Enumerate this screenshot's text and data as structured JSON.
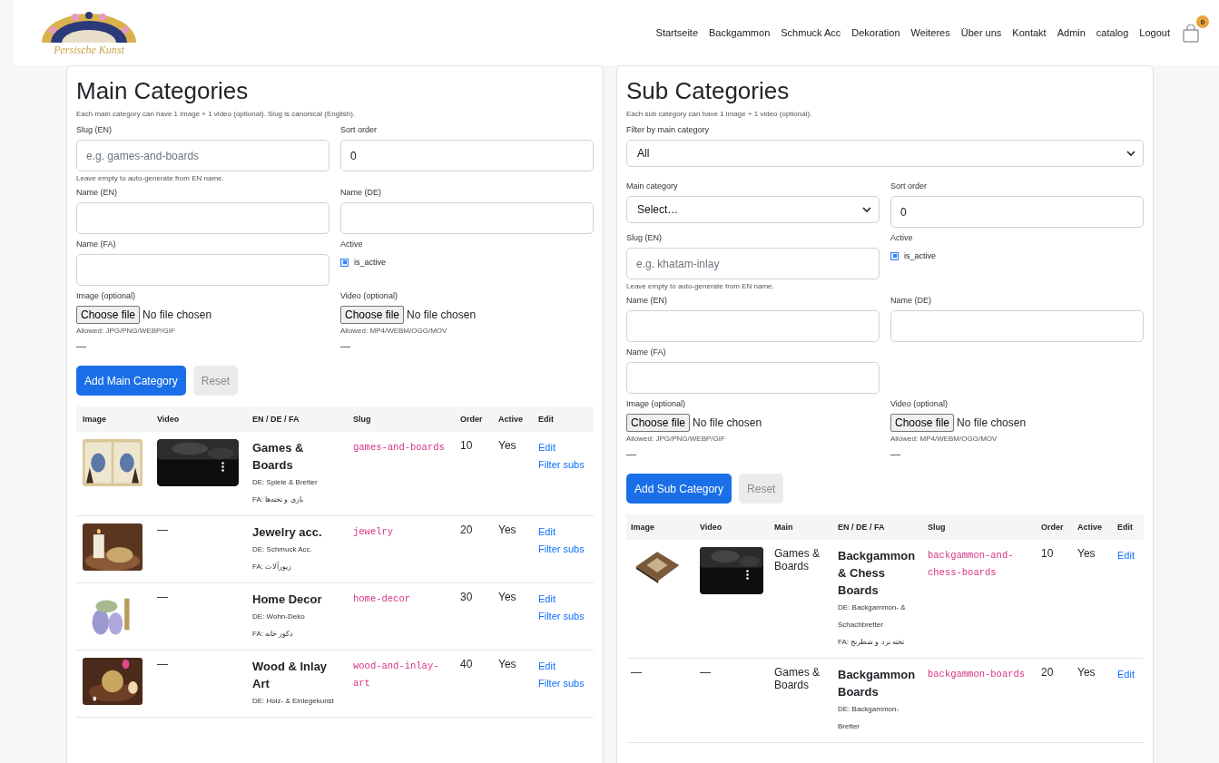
{
  "header": {
    "logo_text": "Persische Kunst",
    "nav": [
      {
        "label": "Startseite"
      },
      {
        "label": "Backgammon"
      },
      {
        "label": "Schmuck Acc"
      },
      {
        "label": "Dekoration"
      },
      {
        "label": "Weiteres"
      },
      {
        "label": "Über uns"
      },
      {
        "label": "Kontakt"
      },
      {
        "label": "Admin"
      },
      {
        "label": "catalog"
      },
      {
        "label": "Logout"
      }
    ],
    "cart_count": "0"
  },
  "panels": [
    {
      "title": "Main Categories",
      "description": "Each main category can have 1 image + 1 video (optional). Slug is canonical (English).",
      "rows": [
        [
          {
            "kind": "input",
            "label": "Slug (EN)",
            "placeholder": "e.g. games-and-boards",
            "hint": "Leave empty to auto-generate from EN name."
          },
          {
            "kind": "input",
            "label": "Sort order",
            "value": "0"
          }
        ],
        [
          {
            "kind": "input",
            "label": "Name (EN)"
          },
          {
            "kind": "input",
            "label": "Name (DE)"
          }
        ],
        [
          {
            "kind": "input",
            "label": "Name (FA)"
          },
          {
            "kind": "checkbox",
            "label": "Active",
            "option": "is_active",
            "checked": true
          }
        ],
        [
          {
            "kind": "file",
            "label": "Image (optional)",
            "button": "Choose file",
            "status": "No file chosen",
            "hint": "Allowed: JPG/PNG/WEBP/GIF",
            "preview": "—"
          },
          {
            "kind": "file",
            "label": "Video (optional)",
            "button": "Choose file",
            "status": "No file chosen",
            "hint": "Allowed: MP4/WEBM/OGG/MOV",
            "preview": "—"
          }
        ]
      ],
      "buttons": [
        {
          "label": "Add Main Category",
          "kind": "primary",
          "disabled": false
        },
        {
          "label": "Reset",
          "kind": "secondary",
          "disabled": true
        }
      ],
      "table": {
        "columns": [
          "Image",
          "Video",
          "EN / DE / FA",
          "Slug",
          "Order",
          "Active",
          "Edit"
        ],
        "rows": [
          {
            "image": {
              "kind": "picture"
            },
            "video": {
              "kind": "picture"
            },
            "name": "Games & Boards",
            "de": "DE: Spiele & Bretter",
            "fa": "FA: بازی و تخته‌ها",
            "slug": "games-and-boards",
            "order": "10",
            "active": "Yes",
            "links": [
              "Edit",
              "Filter subs"
            ]
          },
          {
            "image": {
              "kind": "picture"
            },
            "video": "—",
            "name": "Jewelry acc.",
            "de": "DE: Schmuck Acc.",
            "fa": "FA: زیورآلات",
            "slug": "jewelry",
            "order": "20",
            "active": "Yes",
            "links": [
              "Edit",
              "Filter subs"
            ]
          },
          {
            "image": {
              "kind": "picture"
            },
            "video": "—",
            "name": "Home Decor",
            "de": "DE: Wohn-Deko",
            "fa": "FA: دکور خانه",
            "slug": "home-decor",
            "order": "30",
            "active": "Yes",
            "links": [
              "Edit",
              "Filter subs"
            ]
          },
          {
            "image": {
              "kind": "picture"
            },
            "video": "—",
            "name": "Wood & Inlay Art",
            "de": "DE: Holz- & Einlegekunst",
            "slug": "wood-and-inlay-art",
            "order": "40",
            "active": "Yes",
            "links": [
              "Edit",
              "Filter subs"
            ]
          }
        ]
      }
    },
    {
      "title": "Sub Categories",
      "description": "Each sub category can have 1 image + 1 video (optional).",
      "filter": {
        "label": "Filter by main category",
        "value": "All"
      },
      "rows": [
        [
          {
            "kind": "select",
            "label": "Main category",
            "value": "Select…"
          },
          {
            "kind": "input",
            "label": "Sort order",
            "value": "0"
          }
        ],
        [
          {
            "kind": "input",
            "label": "Slug (EN)",
            "placeholder": "e.g. khatam-inlay",
            "hint": "Leave empty to auto-generate from EN name."
          },
          {
            "kind": "checkbox",
            "label": "Active",
            "option": "is_active",
            "checked": true
          }
        ],
        [
          {
            "kind": "input",
            "label": "Name (EN)"
          },
          {
            "kind": "input",
            "label": "Name (DE)"
          }
        ],
        [
          {
            "kind": "input",
            "label": "Name (FA)"
          }
        ],
        [
          {
            "kind": "file",
            "label": "Image (optional)",
            "button": "Choose file",
            "status": "No file chosen",
            "hint": "Allowed: JPG/PNG/WEBP/GIF",
            "preview": "—"
          },
          {
            "kind": "file",
            "label": "Video (optional)",
            "button": "Choose file",
            "status": "No file chosen",
            "hint": "Allowed: MP4/WEBM/OGG/MOV",
            "preview": "—"
          }
        ]
      ],
      "buttons": [
        {
          "label": "Add Sub Category",
          "kind": "primary",
          "disabled": false
        },
        {
          "label": "Reset",
          "kind": "secondary",
          "disabled": true
        }
      ],
      "table": {
        "columns": [
          "Image",
          "Video",
          "Main",
          "EN / DE / FA",
          "Slug",
          "Order",
          "Active",
          "Edit"
        ],
        "rows": [
          {
            "image": {
              "kind": "picture"
            },
            "video": {
              "kind": "picture"
            },
            "main": "Games & Boards",
            "name": "Backgammon & Chess Boards",
            "de": "DE: Backgammon- & Schachbretter",
            "fa": "FA: تخته نرد و شطرنج",
            "slug": "backgammon-and-chess-boards",
            "order": "10",
            "active": "Yes",
            "links": [
              "Edit"
            ]
          },
          {
            "image": "—",
            "video": "—",
            "main": "Games & Boards",
            "name": "Backgammon Boards",
            "de": "DE: Backgammon-Bretter",
            "slug": "backgammon-boards",
            "order": "20",
            "active": "Yes",
            "links": [
              "Edit"
            ]
          }
        ]
      }
    }
  ]
}
